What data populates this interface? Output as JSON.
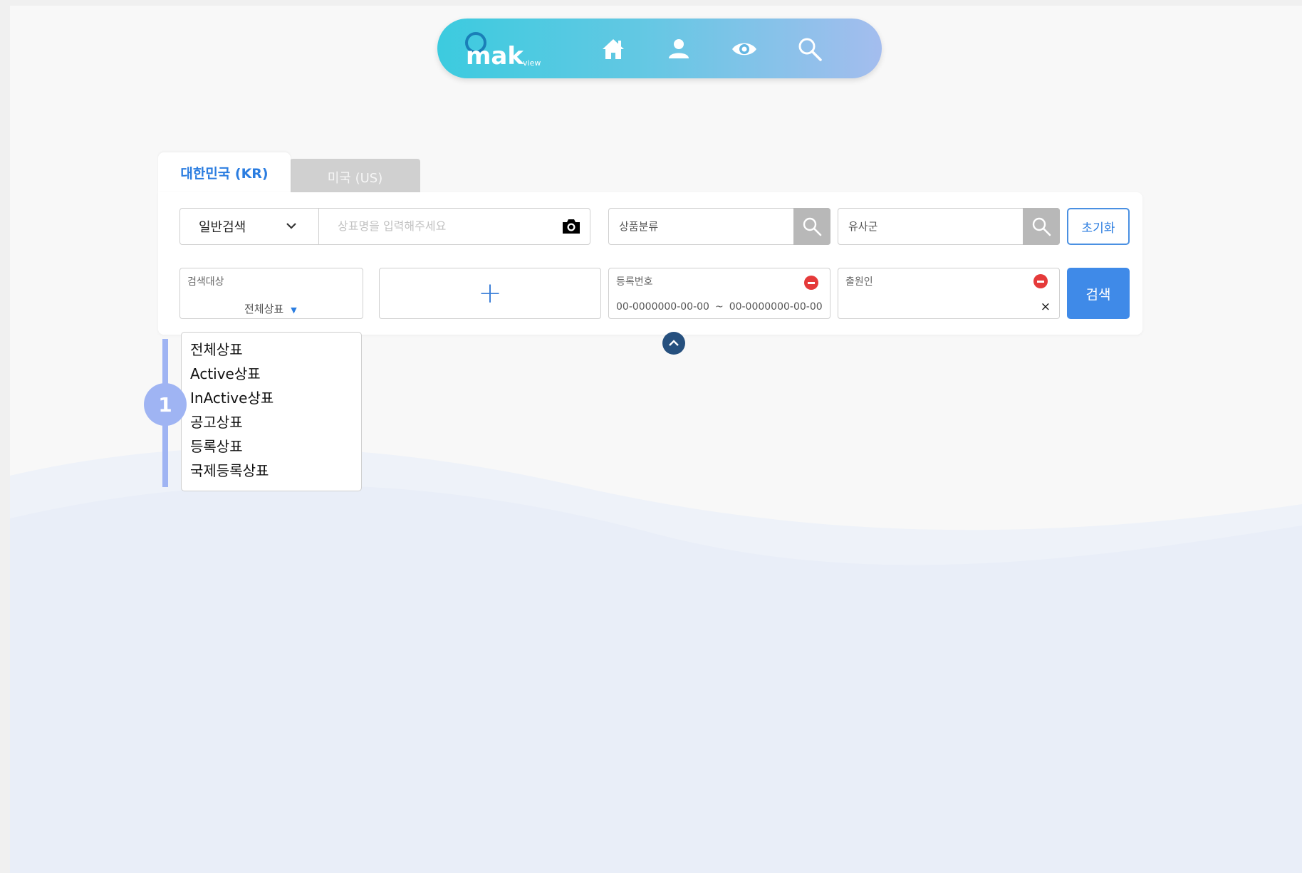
{
  "nav": {
    "logo_text": "mak",
    "logo_sub": "view",
    "icons": [
      "home-icon",
      "user-icon",
      "eye-icon",
      "search-icon"
    ]
  },
  "tabs": [
    {
      "label": "대한민국 (KR)",
      "active": true
    },
    {
      "label": "미국 (US)",
      "active": false
    }
  ],
  "search": {
    "mode": "일반검색",
    "name_placeholder": "상표명을 입력해주세요",
    "class_placeholder": "상품분류",
    "similar_placeholder": "유사군",
    "reset_label": "초기화",
    "target_label": "검색대상",
    "target_value": "전체상표",
    "plus_label": "+",
    "regno_label": "등록번호",
    "regno_from": "00-0000000-00-00",
    "regno_tilde": "~",
    "regno_to": "00-0000000-00-00",
    "applicant_label": "출원인",
    "clear_label": "×",
    "search_label": "검색"
  },
  "dropdown": {
    "items": [
      "전체상표",
      "Active상표",
      "InActive상표",
      "공고상표",
      "등록상표",
      "국제등록상표"
    ]
  },
  "callout": "1",
  "colors": {
    "accent": "#2b7de0",
    "search_button": "#3f8ae8",
    "callout": "#9fb4f3",
    "remove": "#e53a3a"
  }
}
